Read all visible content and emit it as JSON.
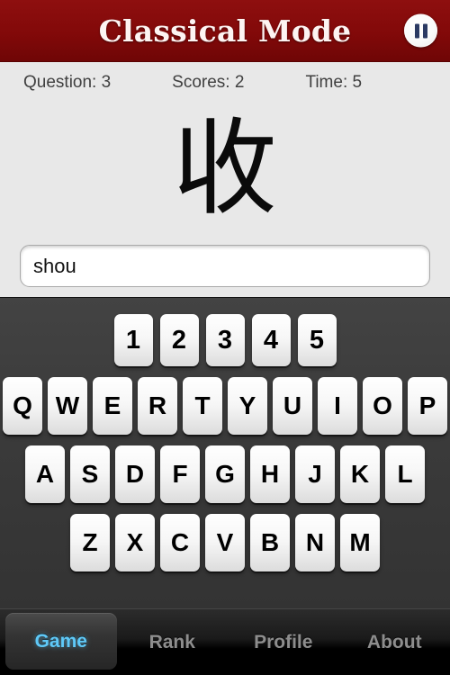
{
  "header": {
    "title": "Classical Mode",
    "pause_icon": "pause-icon",
    "background_color": "#8b0d0d",
    "title_color": "#fdf4f2",
    "pause_bar_color": "#2b3a63"
  },
  "status": {
    "question_label": "Question: 3",
    "scores_label": "Scores: 2",
    "time_label": "Time: 5",
    "text_color": "#404040",
    "background_color": "#e8e8e8"
  },
  "prompt": {
    "character": "收",
    "character_color": "#0b0b0b"
  },
  "answer": {
    "value": "shou",
    "placeholder": ""
  },
  "keyboard": {
    "background_color": "#3e3e3e",
    "key_face_color": "#f6f6f6",
    "key_text_color": "#000000",
    "rows": [
      {
        "name": "number-row",
        "keys": [
          "1",
          "2",
          "3",
          "4",
          "5"
        ]
      },
      {
        "name": "qwerty-row",
        "keys": [
          "Q",
          "W",
          "E",
          "R",
          "T",
          "Y",
          "U",
          "I",
          "O",
          "P"
        ]
      },
      {
        "name": "home-row",
        "keys": [
          "A",
          "S",
          "D",
          "F",
          "G",
          "H",
          "J",
          "K",
          "L"
        ]
      },
      {
        "name": "bottom-row",
        "keys": [
          "Z",
          "X",
          "C",
          "V",
          "B",
          "N",
          "M"
        ]
      }
    ]
  },
  "tabbar": {
    "active_color": "#5fc9f8",
    "inactive_color": "#8d8d8d",
    "tabs": [
      {
        "label": "Game",
        "active": true
      },
      {
        "label": "Rank",
        "active": false
      },
      {
        "label": "Profile",
        "active": false
      },
      {
        "label": "About",
        "active": false
      }
    ]
  }
}
